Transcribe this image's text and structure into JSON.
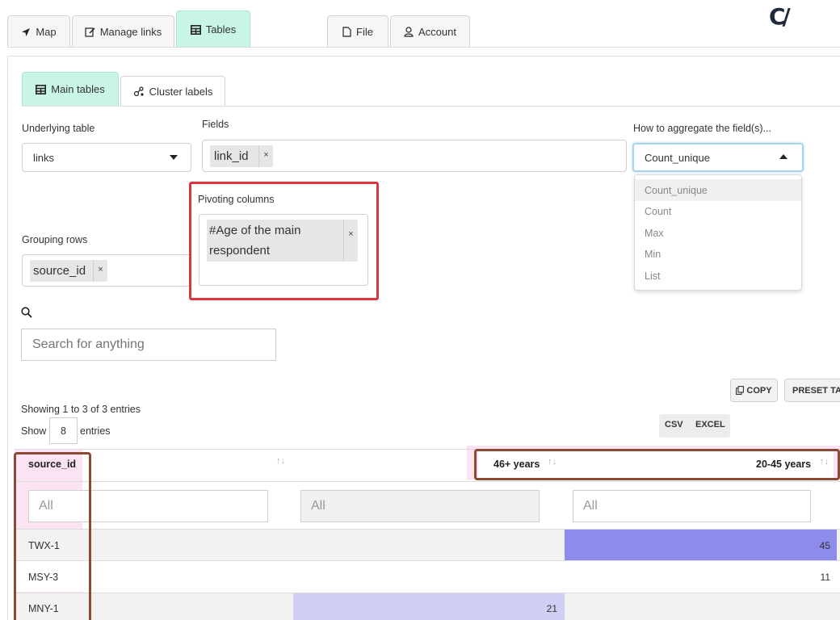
{
  "top_tabs": {
    "map": "Map",
    "manage_links": "Manage links",
    "tables": "Tables",
    "file": "File",
    "account": "Account"
  },
  "logo_text": "C/",
  "sub_tabs": {
    "main_tables": "Main tables",
    "cluster_labels": "Cluster labels"
  },
  "form": {
    "underlying_table_label": "Underlying table",
    "underlying_table_value": "links",
    "fields_label": "Fields",
    "fields_chip": "link_id",
    "aggregate_label": "How to aggregate the field(s)...",
    "aggregate_value": "Count_unique",
    "aggregate_options": [
      "Count_unique",
      "Count",
      "Max",
      "Min",
      "List"
    ],
    "pivoting_label": "Pivoting columns",
    "pivoting_chip_line1": "#Age of the main",
    "pivoting_chip_line2": "respondent",
    "grouping_label": "Grouping rows",
    "grouping_chip": "source_id",
    "remove_symbol": "×"
  },
  "search": {
    "placeholder": "Search for anything"
  },
  "toolbar": {
    "copy": "COPY",
    "preset": "PRESET TA",
    "csv": "CSV",
    "excel": "EXCEL"
  },
  "entries": {
    "info": "Showing 1 to 3 of 3 entries",
    "show_label": "Show",
    "show_value": "8",
    "entries_label": "entries"
  },
  "table": {
    "headers": [
      "source_id",
      "46+ years",
      "20-45 years"
    ],
    "sort_symbol": "↑↓",
    "filter_placeholder": "All",
    "rows": [
      {
        "source_id": "TWX-1",
        "age_46_plus": "",
        "age_20_45": "45"
      },
      {
        "source_id": "MSY-3",
        "age_46_plus": "",
        "age_20_45": "11"
      },
      {
        "source_id": "MNY-1",
        "age_46_plus": "21",
        "age_20_45": ""
      }
    ]
  },
  "colors": {
    "active_tab": "#c9f5e5",
    "highlight_red": "#d9363e",
    "highlight_brown": "#8c4a35",
    "bar_strong": "#8e8cea",
    "bar_light": "#d0cff4",
    "pink_column": "#fbe3f3"
  }
}
